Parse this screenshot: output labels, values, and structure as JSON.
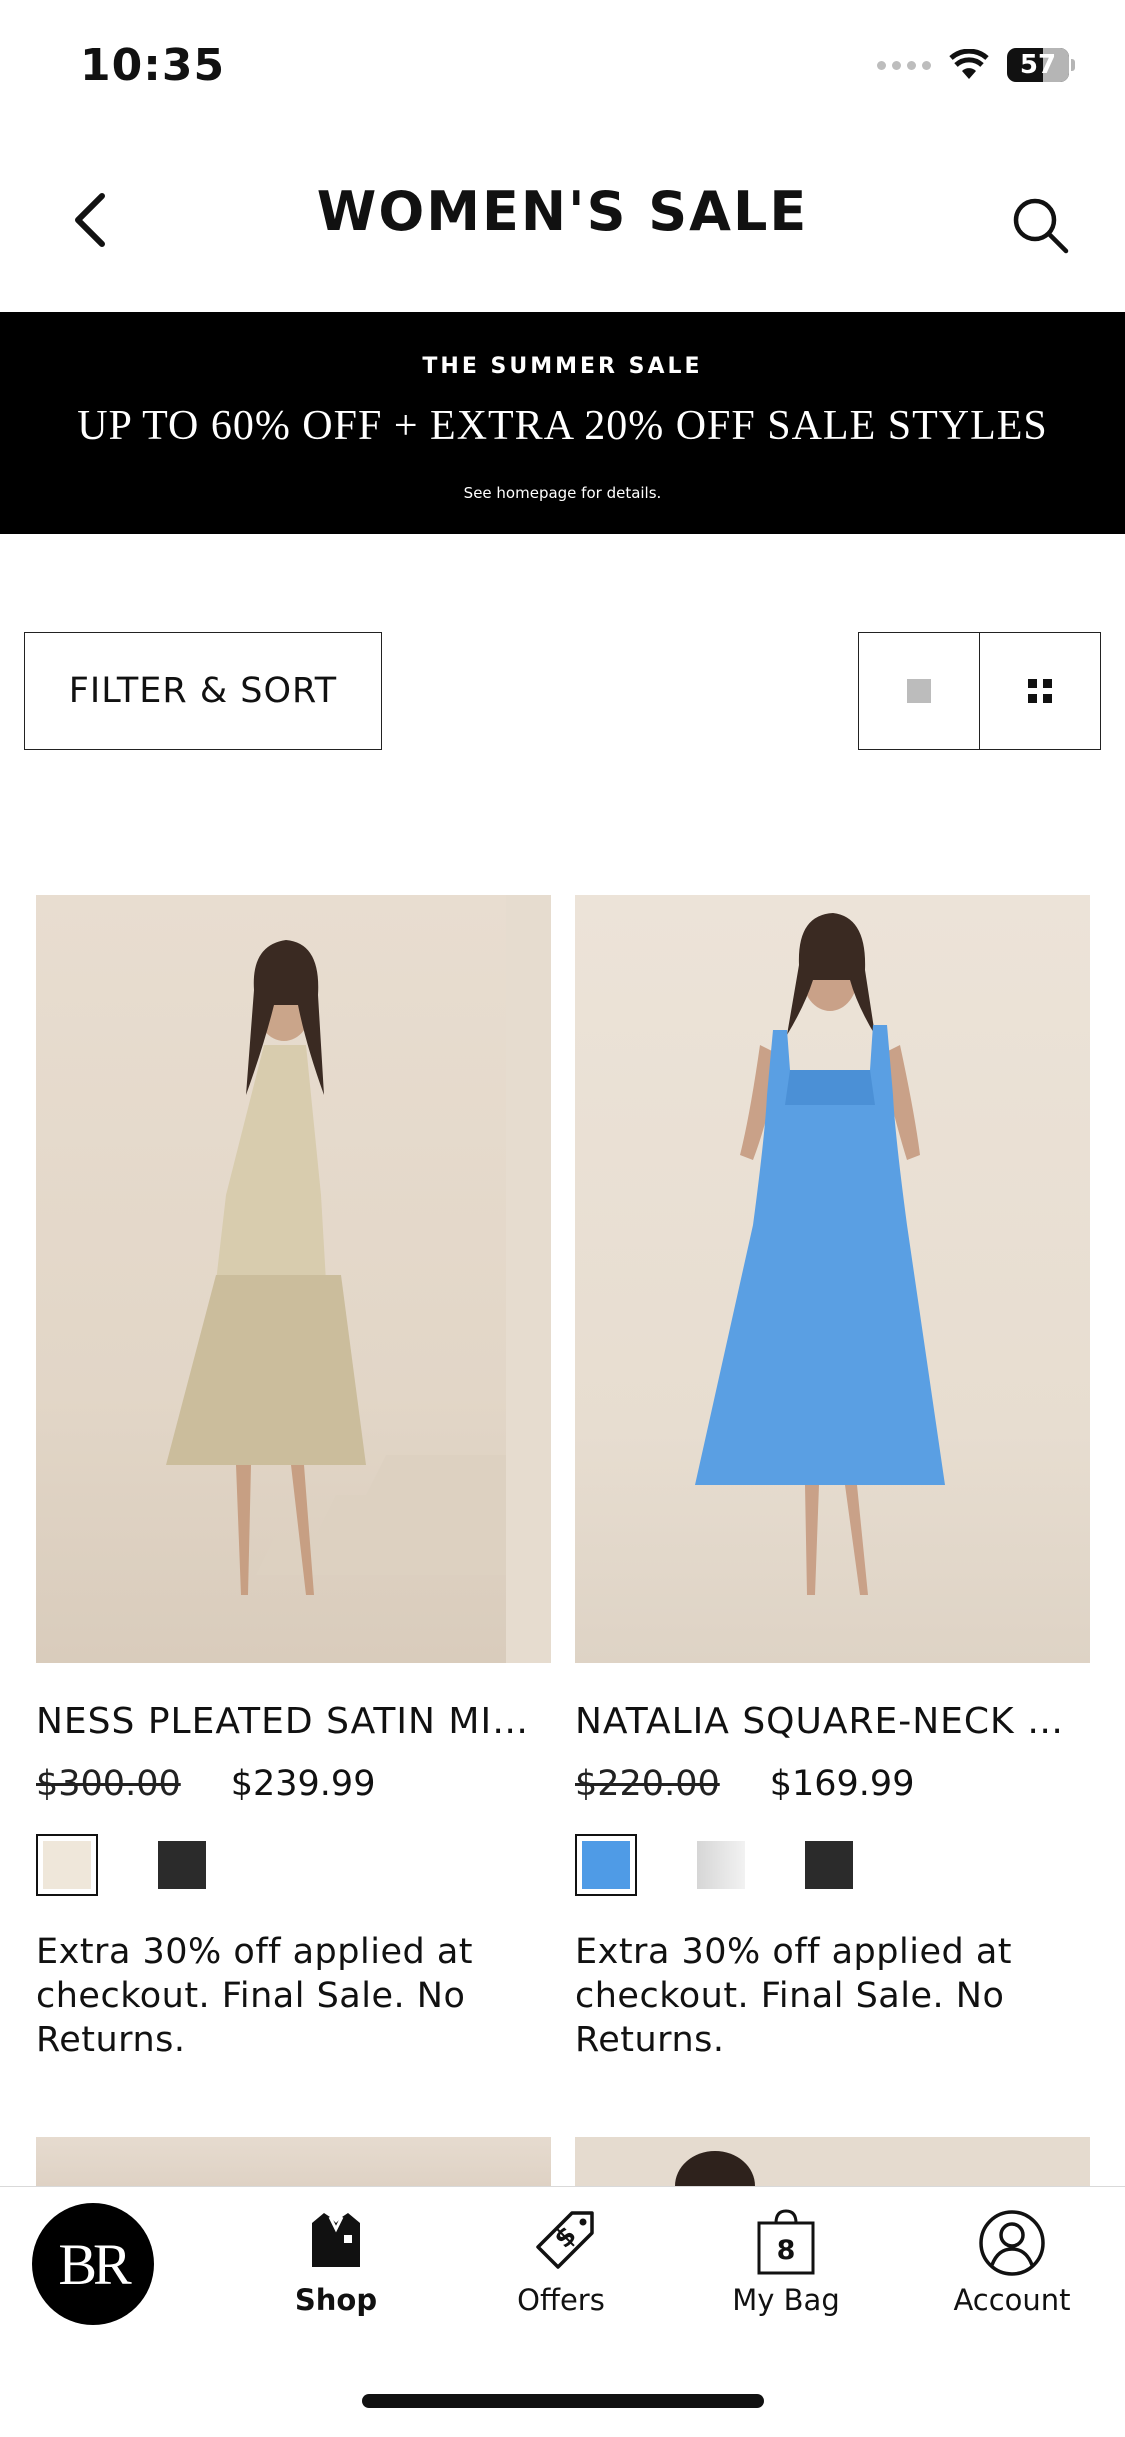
{
  "status_bar": {
    "time": "10:35",
    "battery": "57"
  },
  "header": {
    "title": "WOMEN'S SALE",
    "back_icon": "chevron-left-icon",
    "search_icon": "search-icon"
  },
  "banner": {
    "eyebrow": "THE SUMMER SALE",
    "headline": "UP TO 60% OFF + EXTRA 20% OFF SALE STYLES",
    "fine_print": "See homepage for details."
  },
  "toolbar": {
    "filter_label": "FILTER & SORT"
  },
  "products": [
    {
      "name": "NESS PLEATED SATIN MIDI DRESS",
      "original_price": "$300.00",
      "sale_price": "$239.99",
      "swatches": [
        "#efe7da",
        "#2b2b2b"
      ],
      "promo": "Extra 30% off applied at checkout. Final Sale. No Returns."
    },
    {
      "name": "NATALIA SQUARE-NECK MIDI DRESS",
      "original_price": "$220.00",
      "sale_price": "$169.99",
      "swatches": [
        "#4f9be6",
        "#e3e3e3",
        "#2b2b2b"
      ],
      "promo": "Extra 30% off applied at checkout. Final Sale. No Returns."
    }
  ],
  "tabbar": {
    "logo_text": "BR",
    "shop_label": "Shop",
    "offers_label": "Offers",
    "bag_label": "My Bag",
    "bag_count": "8",
    "account_label": "Account"
  },
  "colors": {
    "banner_bg": "#000000",
    "accent": "#111111"
  }
}
